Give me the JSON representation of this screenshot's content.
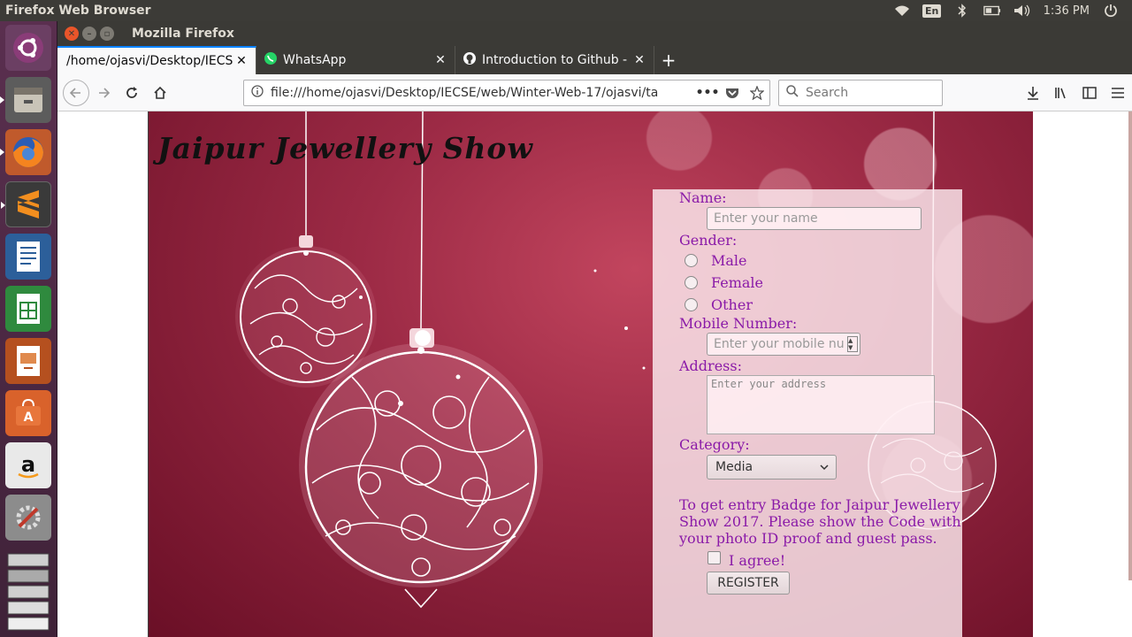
{
  "system_panel": {
    "app_title": "Firefox Web Browser",
    "keyboard_layout": "En",
    "clock": "1:36 PM",
    "icons": [
      "wifi-icon",
      "keyboard-icon",
      "bluetooth-icon",
      "battery-icon",
      "volume-icon",
      "power-icon"
    ]
  },
  "launcher": {
    "items": [
      "ubuntu-dash",
      "files",
      "firefox",
      "sublime-text",
      "libreoffice-writer",
      "libreoffice-calc",
      "libreoffice-impress",
      "ubuntu-software",
      "amazon",
      "system-settings",
      "trash"
    ]
  },
  "window": {
    "title": "Mozilla Firefox"
  },
  "tabs": [
    {
      "label": "/home/ojasvi/Desktop/IECS",
      "active": true
    },
    {
      "label": "WhatsApp",
      "active": false
    },
    {
      "label": "Introduction to Github -",
      "active": false
    }
  ],
  "navbar": {
    "url": "file:///home/ojasvi/Desktop/IECSE/web/Winter-Web-17/ojasvi/ta",
    "search_placeholder": "Search"
  },
  "page": {
    "site_title": "Jaipur Jewellery Show",
    "form": {
      "name_label": "Name:",
      "name_placeholder": "Enter your name",
      "gender_label": "Gender:",
      "gender_options": [
        "Male",
        "Female",
        "Other"
      ],
      "mobile_label": "Mobile Number:",
      "mobile_placeholder": "Enter your mobile nu",
      "address_label": "Address:",
      "address_placeholder": "Enter your address",
      "category_label": "Category:",
      "category_value": "Media",
      "note": "To get entry Badge for Jaipur Jewellery Show 2017. Please show the Code with your photo ID proof and guest pass.",
      "agree_label": "I agree!",
      "register_label": "REGISTER"
    }
  },
  "colors": {
    "form_text": "#8a1aa8",
    "tab_accent": "#0a84ff",
    "background_red": "#9c2a45"
  }
}
